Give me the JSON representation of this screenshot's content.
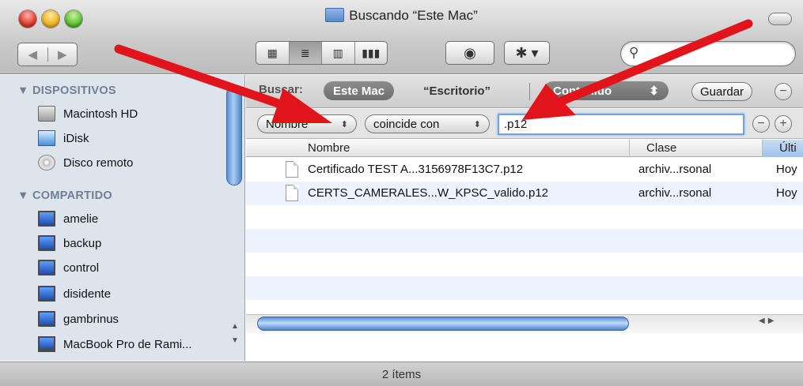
{
  "window": {
    "title": "Buscando “Este Mac”"
  },
  "toolbar": {
    "back_glyph": "◀",
    "forward_glyph": "▶",
    "views": [
      "▦",
      "≣",
      "▥",
      "▮▮▮"
    ],
    "quicklook_glyph": "◉",
    "action_glyph": "✱ ▾",
    "search_placeholder": ""
  },
  "sidebar": {
    "devices_header": "▼ DISPOSITIVOS",
    "devices": [
      "Macintosh HD",
      "iDisk",
      "Disco remoto"
    ],
    "shared_header": "▼ COMPARTIDO",
    "shared": [
      "amelie",
      "backup",
      "control",
      "disidente",
      "gambrinus",
      "MacBook Pro de Rami..."
    ]
  },
  "scope": {
    "label": "Buscar:",
    "this_mac": "Este Mac",
    "desktop": "“Escritorio”",
    "contents": "Contenido",
    "contents_arrow": "⬍",
    "save": "Guardar",
    "minus": "−"
  },
  "criteria": {
    "attribute": "Nombre",
    "operator": "coincide con",
    "popup_arrow": "⬍",
    "value": ".p12",
    "minus": "−",
    "plus": "+"
  },
  "columns": {
    "name": "Nombre",
    "kind": "Clase",
    "date": "Últi"
  },
  "files": [
    {
      "name": "Certificado TEST A...3156978F13C7.p12",
      "kind": "archiv...rsonal",
      "date": "Hoy"
    },
    {
      "name": "CERTS_CAMERALES...W_KPSC_valido.p12",
      "kind": "archiv...rsonal",
      "date": "Hoy"
    }
  ],
  "status": {
    "count": "2 ítems"
  },
  "colors": {
    "arrow": "#e0141a",
    "sidebar_bg": "#dee4ec",
    "row_alt": "#edf3fe",
    "focus": "#6ea4e6"
  }
}
